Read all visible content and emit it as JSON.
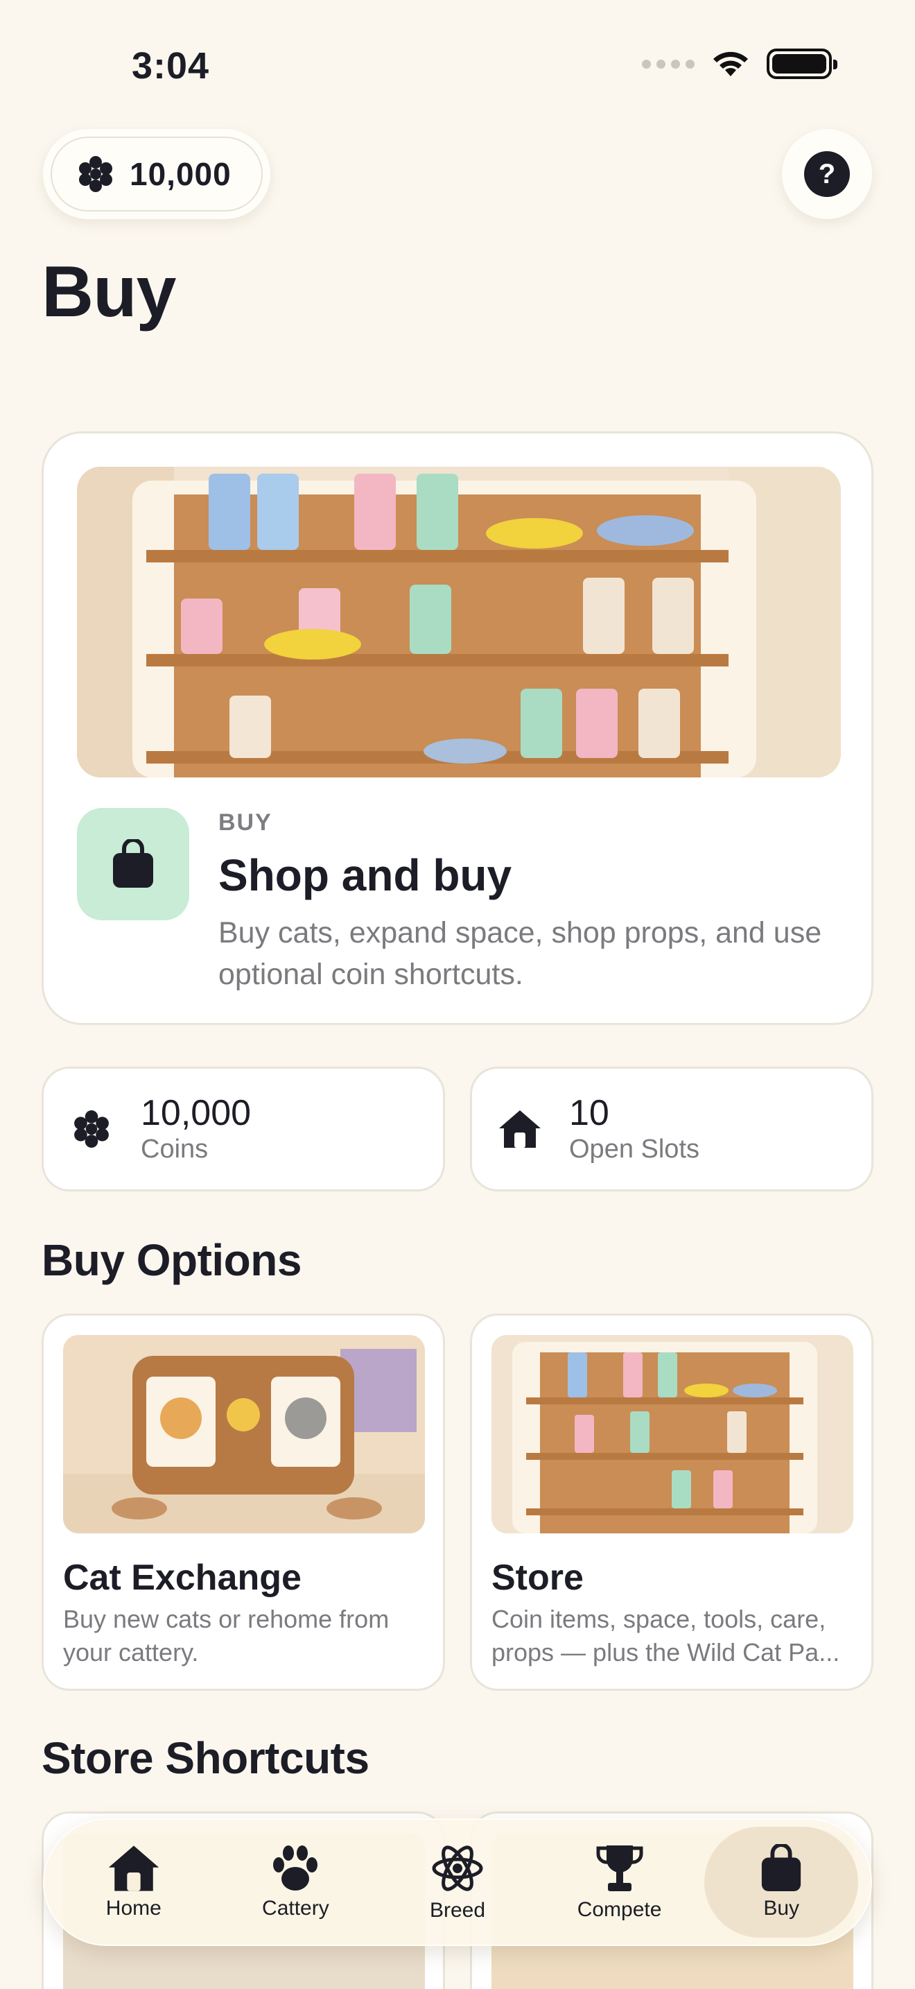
{
  "status_bar": {
    "time": "3:04"
  },
  "header": {
    "coins": "10,000",
    "help_label": "?",
    "title": "Buy"
  },
  "hero": {
    "eyebrow": "BUY",
    "title": "Shop and buy",
    "description": "Buy cats, expand space, shop props, and use optional coin shortcuts."
  },
  "stats": [
    {
      "value": "10,000",
      "label": "Coins",
      "icon": "coin-cluster-icon"
    },
    {
      "value": "10",
      "label": "Open Slots",
      "icon": "house-icon"
    }
  ],
  "buy_options": {
    "title": "Buy Options",
    "items": [
      {
        "title": "Cat Exchange",
        "description": "Buy new cats or rehome from your cattery."
      },
      {
        "title": "Store",
        "description": "Coin items, space, tools, care, props — plus the Wild Cat Pa..."
      }
    ]
  },
  "shortcuts": {
    "title": "Store Shortcuts"
  },
  "tabs": [
    {
      "label": "Home",
      "icon": "house-icon",
      "active": false
    },
    {
      "label": "Cattery",
      "icon": "paw-icon",
      "active": false
    },
    {
      "label": "Breed",
      "icon": "atom-icon",
      "active": false
    },
    {
      "label": "Compete",
      "icon": "trophy-icon",
      "active": false
    },
    {
      "label": "Buy",
      "icon": "bag-icon",
      "active": true
    }
  ],
  "colors": {
    "background": "#fbf7ef",
    "accent_green": "#c8ecd5",
    "text_dark": "#1c1d26",
    "text_muted": "#7a7a7f"
  }
}
